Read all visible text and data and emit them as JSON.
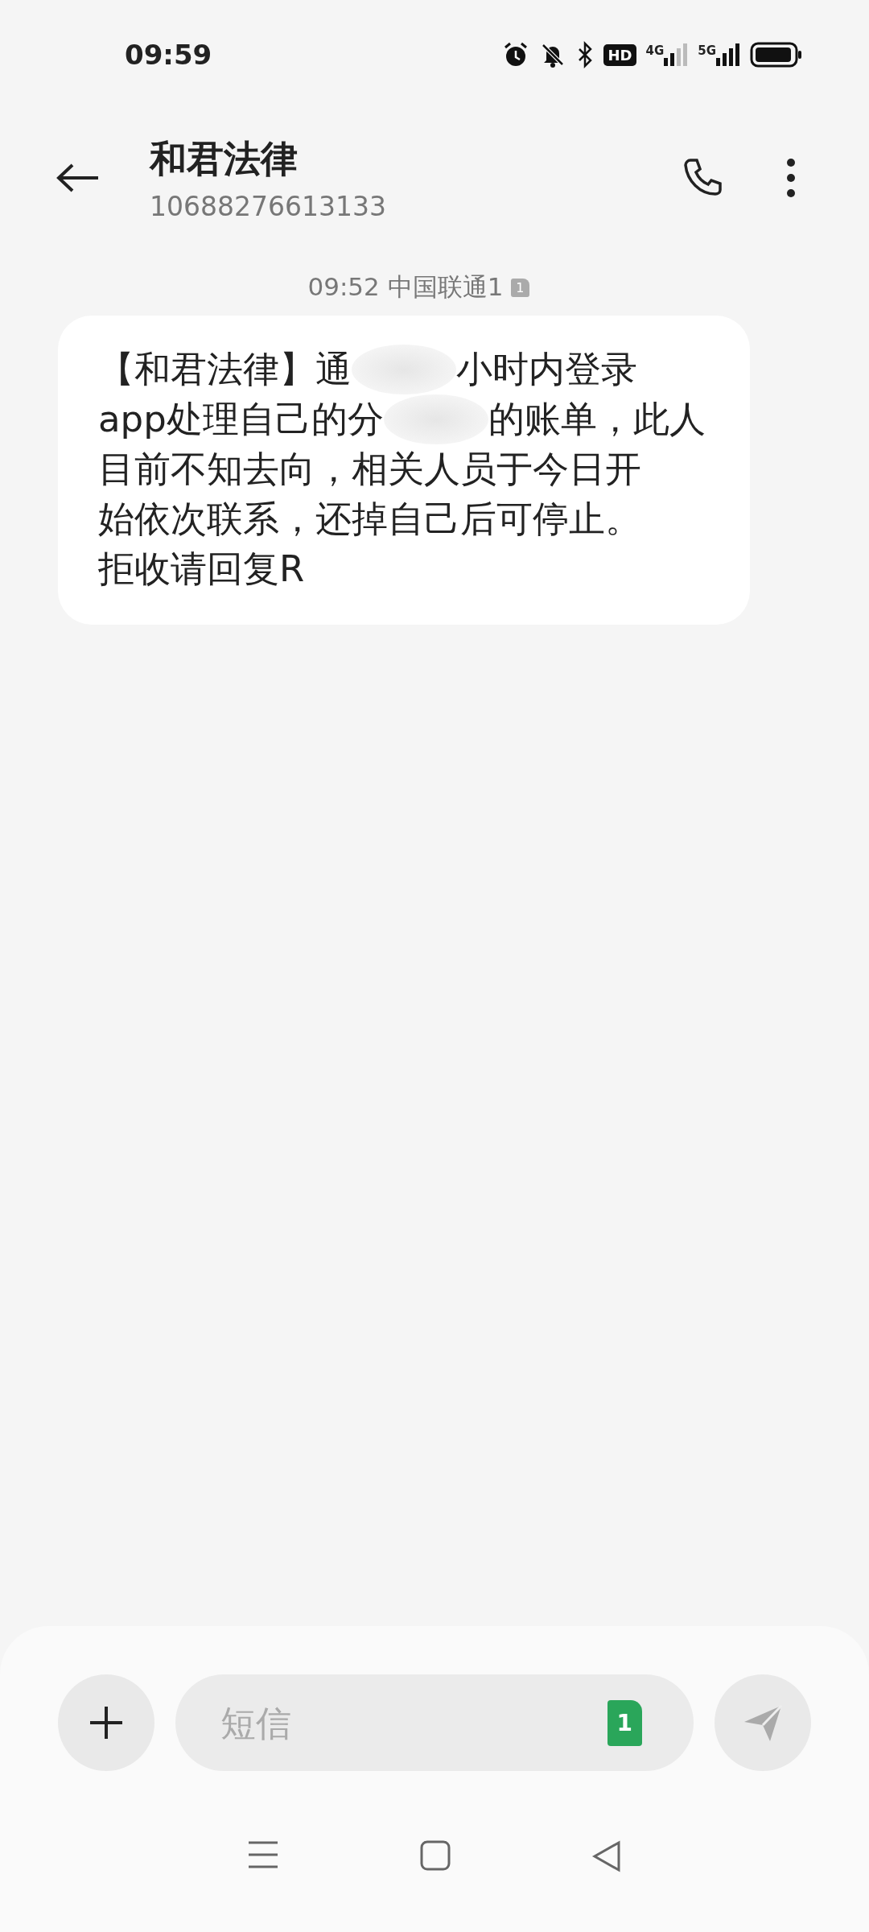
{
  "status_bar": {
    "time": "09:59",
    "hd_label": "HD",
    "network_labels": [
      "4G",
      "5G"
    ]
  },
  "header": {
    "title": "和君法律",
    "subtitle": "10688276613133"
  },
  "timestamp": {
    "time": "09:52",
    "carrier": "中国联通1",
    "sim": "1"
  },
  "message": {
    "lines": [
      [
        {
          "kind": "text",
          "text": "【和君法律】通"
        },
        {
          "kind": "redacted"
        },
        {
          "kind": "text",
          "text": "小时内登录"
        }
      ],
      [
        {
          "kind": "text",
          "text": "app处理自己的分"
        },
        {
          "kind": "redacted"
        },
        {
          "kind": "text",
          "text": "的账单，此人"
        }
      ],
      [
        {
          "kind": "text",
          "text": "目前不知去向，相关人员于今日开"
        }
      ],
      [
        {
          "kind": "text",
          "text": "始依次联系，还掉自己后可停止。"
        }
      ],
      [
        {
          "kind": "text",
          "text": "拒收请回复R"
        }
      ]
    ]
  },
  "composer": {
    "placeholder": "短信",
    "sim": "1"
  }
}
